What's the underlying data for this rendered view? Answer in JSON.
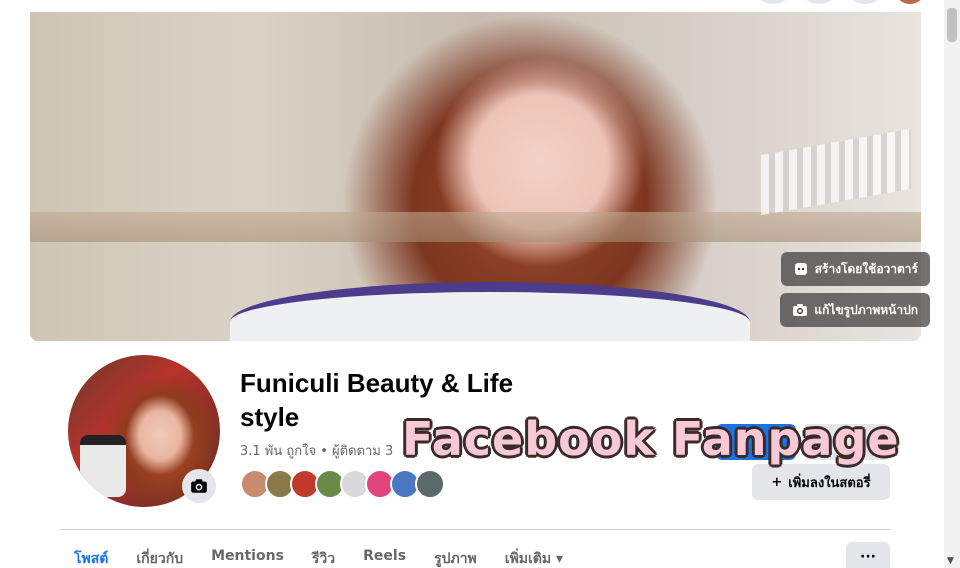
{
  "cover": {
    "avatar_button_label": "สร้างโดยใช้อวาตาร์",
    "edit_cover_label": "แก้ไขรูปภาพหน้าปก"
  },
  "profile": {
    "page_name": "Funiculi Beauty & Life style",
    "stats": "3.1 พัน ถูกใจ • ผู้ติดตาม 3"
  },
  "followers": {
    "avatar_colors": [
      "#c98b6e",
      "#8a7a4a",
      "#c0392b",
      "#6a8a4a",
      "#d9dadc",
      "#e0457b",
      "#4a78c0",
      "#5a6a6a"
    ]
  },
  "actions": {
    "add_to_story_label": "เพิ่มลงในสตอรี่"
  },
  "overlay": {
    "title": "Facebook Fanpage"
  },
  "tabs": [
    {
      "label": "โพสต์",
      "active": true
    },
    {
      "label": "เกี่ยวกับ"
    },
    {
      "label": "Mentions"
    },
    {
      "label": "รีวิว"
    },
    {
      "label": "Reels"
    },
    {
      "label": "รูปภาพ"
    },
    {
      "label": "เพิ่มเติม"
    }
  ],
  "more_button_label": "···",
  "colors": {
    "primary": "#1b74e4",
    "button_gray": "#e4e6eb",
    "text": "#050505",
    "secondary_text": "#65676b"
  }
}
